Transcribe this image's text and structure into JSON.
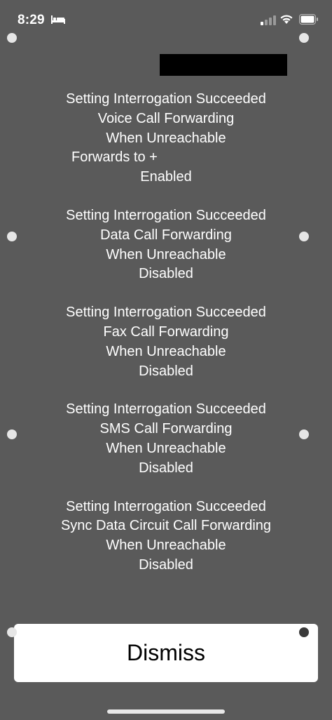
{
  "status_bar": {
    "time": "8:29"
  },
  "icons": [
    "bed-icon",
    "signal-icon",
    "wifi-icon",
    "battery-icon"
  ],
  "message": {
    "blocks": [
      {
        "lines": [
          "Setting Interrogation Succeeded",
          "Voice Call Forwarding",
          "When Unreachable",
          "Forwards to +",
          "Enabled"
        ]
      },
      {
        "lines": [
          "Setting Interrogation Succeeded",
          "Data Call Forwarding",
          "When Unreachable",
          "Disabled"
        ]
      },
      {
        "lines": [
          "Setting Interrogation Succeeded",
          "Fax Call Forwarding",
          "When Unreachable",
          "Disabled"
        ]
      },
      {
        "lines": [
          "Setting Interrogation Succeeded",
          "SMS Call Forwarding",
          "When Unreachable",
          "Disabled"
        ]
      },
      {
        "lines": [
          "Setting Interrogation Succeeded",
          "Sync Data Circuit Call Forwarding",
          "When Unreachable",
          "Disabled"
        ]
      }
    ]
  },
  "dismiss_button": {
    "label": "Dismiss"
  },
  "colors": {
    "background": "#5a5a5a",
    "text": "#ffffff",
    "button_bg": "#ffffff"
  }
}
